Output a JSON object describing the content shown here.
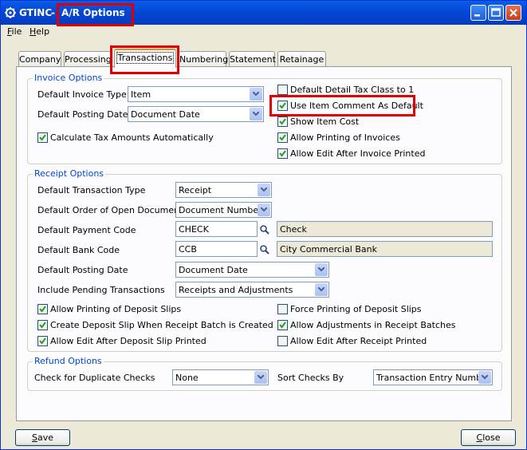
{
  "window": {
    "company": "GTINC",
    "separator": " - ",
    "title": "A/R Options"
  },
  "menu": {
    "file_accel": "F",
    "file_rest": "ile",
    "help_accel": "H",
    "help_rest": "elp"
  },
  "tabs": [
    {
      "label": "Company"
    },
    {
      "label": "Processing"
    },
    {
      "label": "Transactions",
      "selected": true
    },
    {
      "label": "Numbering"
    },
    {
      "label": "Statement"
    },
    {
      "label": "Retainage"
    }
  ],
  "invoice": {
    "title": "Invoice Options",
    "type_label": "Default Invoice Type",
    "type_value": "Item",
    "posting_label": "Default Posting Date",
    "posting_value": "Document Date",
    "calc_tax": {
      "label": "Calculate Tax Amounts Automatically",
      "checked": true
    },
    "detail_tax": {
      "label": "Default Detail Tax Class to 1",
      "checked": false
    },
    "item_comment": {
      "label": "Use Item Comment As Default",
      "checked": true
    },
    "show_cost": {
      "label": "Show Item Cost",
      "checked": true
    },
    "allow_print": {
      "label": "Allow Printing of Invoices",
      "checked": true
    },
    "allow_edit": {
      "label": "Allow Edit After Invoice Printed",
      "checked": true
    }
  },
  "receipt": {
    "title": "Receipt Options",
    "trans_type_label": "Default Transaction Type",
    "trans_type_value": "Receipt",
    "order_label": "Default Order of Open Documents",
    "order_value": "Document Number",
    "payment_label": "Default Payment Code",
    "payment_code": "CHECK",
    "payment_desc": "Check",
    "bank_label": "Default Bank Code",
    "bank_code": "CCB",
    "bank_desc": "City Commercial Bank",
    "posting_label": "Default Posting Date",
    "posting_value": "Document Date",
    "pending_label": "Include Pending Transactions",
    "pending_value": "Receipts and Adjustments",
    "allow_deposit": {
      "label": "Allow Printing of Deposit Slips",
      "checked": true
    },
    "create_deposit": {
      "label": "Create Deposit Slip When Receipt Batch is Created",
      "checked": true
    },
    "edit_deposit": {
      "label": "Allow Edit After Deposit Slip Printed",
      "checked": true
    },
    "force_deposit": {
      "label": "Force Printing of Deposit Slips",
      "checked": false
    },
    "allow_adjust": {
      "label": "Allow Adjustments in Receipt Batches",
      "checked": true
    },
    "edit_receipt": {
      "label": "Allow Edit After Receipt Printed",
      "checked": false
    }
  },
  "refund": {
    "title": "Refund Options",
    "dup_label": "Check for Duplicate Checks",
    "dup_value": "None",
    "sort_label": "Sort Checks By",
    "sort_value": "Transaction Entry Number"
  },
  "buttons": {
    "save_accel": "S",
    "save_rest": "ave",
    "close_accel": "C",
    "close_rest": "lose"
  },
  "colors": {
    "title_bar": "#0548D8",
    "face": "#ECE9D8",
    "group_title": "#0046D5",
    "highlight": "#E00000"
  }
}
